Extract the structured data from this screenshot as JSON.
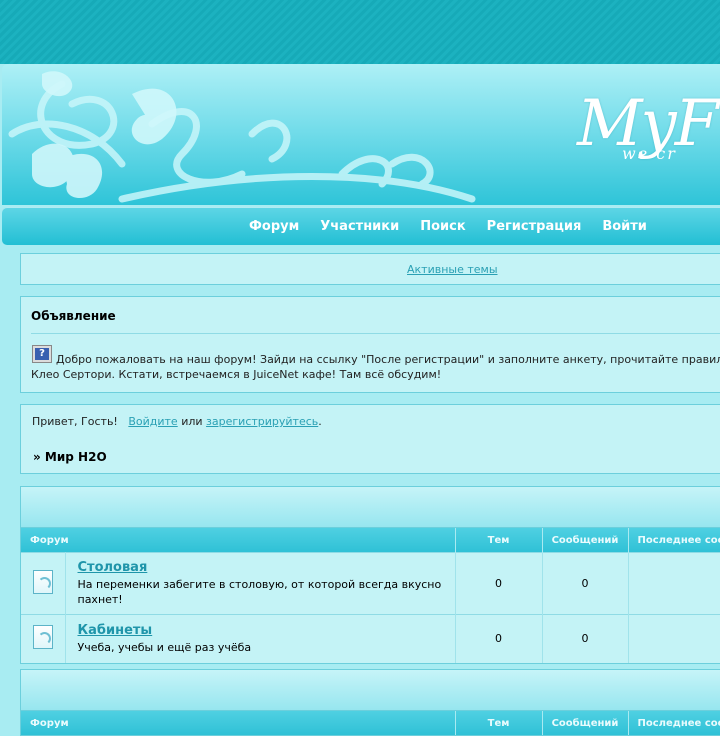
{
  "header": {
    "logo_text": "MyF",
    "logo_tagline": "we cr"
  },
  "nav": [
    "Форум",
    "Участники",
    "Поиск",
    "Регистрация",
    "Войти"
  ],
  "active_topics_link": "Активные темы",
  "announcement": {
    "title": "Объявление",
    "icon": "question-icon",
    "line1": "Добро пожаловать на наш форум! Зайди на ссылку \"После регистрации\" и заполните анкету, прочитайте правил",
    "line2": "Клео Сертори. Кстати, встречаемся в JuiceNet кафе! Там всё обсудим!"
  },
  "greeting": {
    "prefix": "Привет, Гость!",
    "login": "Войдите",
    "or": "или",
    "register": "зарегистрируйтесь",
    "suffix": ".",
    "breadcrumb": "» Мир H2O"
  },
  "table_headers": {
    "forum": "Форум",
    "topics": "Тем",
    "posts": "Сообщений",
    "last": "Последнее сообщение"
  },
  "forums": [
    {
      "name": "Столовая",
      "desc": "На переменки забегите в столовую, от которой всегда вкусно пахнет!",
      "topics": "0",
      "posts": "0"
    },
    {
      "name": "Кабинеты",
      "desc": "Учеба, учебы и ещё раз учёба",
      "topics": "0",
      "posts": "0"
    }
  ],
  "colors": {
    "accent": "#2fc1d6",
    "link": "#2aa0b4",
    "panel_bg": "#c4f3f6"
  }
}
